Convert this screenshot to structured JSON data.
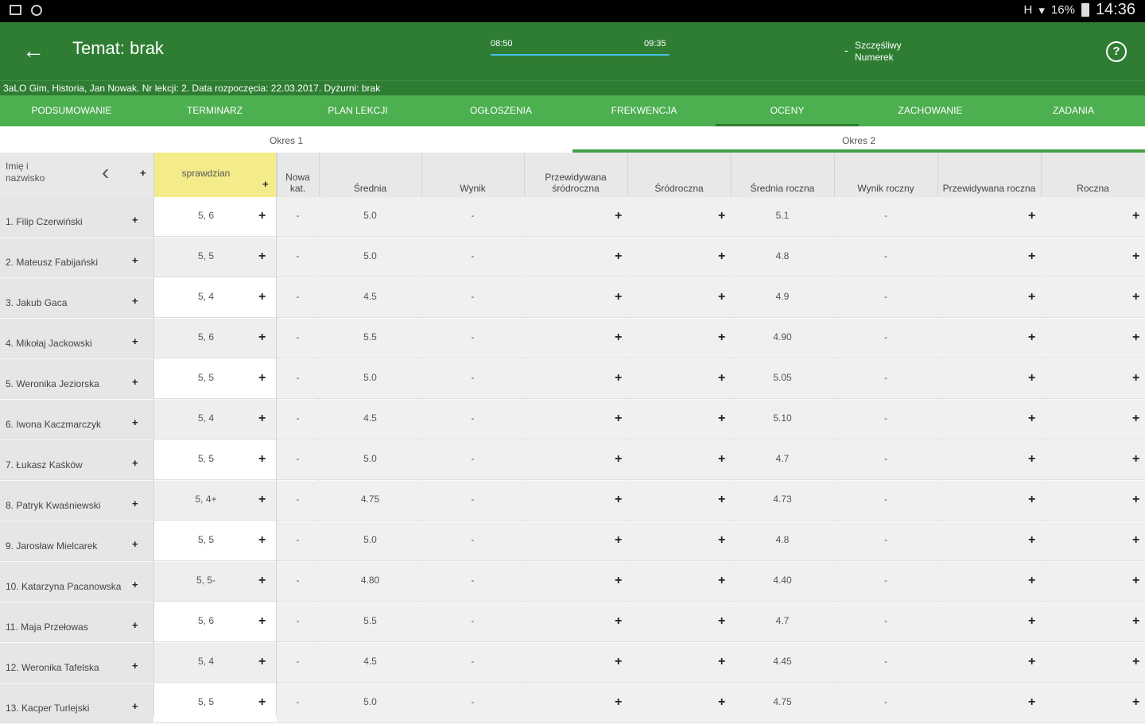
{
  "status_bar": {
    "signal_label": "H",
    "battery": "16%",
    "time": "14:36"
  },
  "app_bar": {
    "back_icon": "arrow-left-icon",
    "title": "Temat: brak",
    "time_start": "08:50",
    "time_end": "09:35",
    "lesson_progress": 1.0,
    "lucky_dash": "-",
    "lucky_label": "Szczęśliwy Numerek",
    "help_icon": "help-circle-icon",
    "help_glyph": "?"
  },
  "info_line": "3aLO Gim, Historia, Jan Nowak. Nr lekcji: 2. Data rozpoczęcia: 22.03.2017. Dyżurni: brak",
  "tabs": [
    {
      "label": "PODSUMOWANIE"
    },
    {
      "label": "TERMINARZ"
    },
    {
      "label": "PLAN LEKCJI"
    },
    {
      "label": "OGŁOSZENIA"
    },
    {
      "label": "FREKWENCJA"
    },
    {
      "label": "OCENY",
      "active": true
    },
    {
      "label": "ZACHOWANIE"
    },
    {
      "label": "ZADANIA"
    }
  ],
  "periods": [
    {
      "label": "Okres 1"
    },
    {
      "label": "Okres 2",
      "active": true
    }
  ],
  "table": {
    "name_header": "Imię i nazwisko",
    "collapse_glyph": "‹",
    "plus_glyph": "+",
    "grade_header": "sprawdzian",
    "columns": [
      "Nowa kat.",
      "Średnia",
      "Wynik",
      "Przewidywana śródroczna",
      "Śródroczna",
      "Średnia roczna",
      "Wynik roczny",
      "Przewidywana roczna",
      "Roczna"
    ],
    "accent_color": "#f4ec8b",
    "rows": [
      {
        "name": "1. Filip Czerwiński",
        "grades": "5, 6",
        "nowa": "-",
        "srednia": "5.0",
        "wynik": "-",
        "srednia_roczna": "5.1",
        "wynik_roczny": "-"
      },
      {
        "name": "2. Mateusz Fabijański",
        "grades": "5, 5",
        "nowa": "-",
        "srednia": "5.0",
        "wynik": "-",
        "srednia_roczna": "4.8",
        "wynik_roczny": "-"
      },
      {
        "name": "3. Jakub Gaca",
        "grades": "5, 4",
        "nowa": "-",
        "srednia": "4.5",
        "wynik": "-",
        "srednia_roczna": "4.9",
        "wynik_roczny": "-"
      },
      {
        "name": "4. Mikołaj Jackowski",
        "grades": "5, 6",
        "nowa": "-",
        "srednia": "5.5",
        "wynik": "-",
        "srednia_roczna": "4.90",
        "wynik_roczny": "-"
      },
      {
        "name": "5. Weronika Jeziorska",
        "grades": "5, 5",
        "nowa": "-",
        "srednia": "5.0",
        "wynik": "-",
        "srednia_roczna": "5.05",
        "wynik_roczny": "-"
      },
      {
        "name": "6. Iwona Kaczmarczyk",
        "grades": "5, 4",
        "nowa": "-",
        "srednia": "4.5",
        "wynik": "-",
        "srednia_roczna": "5.10",
        "wynik_roczny": "-"
      },
      {
        "name": "7. Łukasz Kaśków",
        "grades": "5, 5",
        "nowa": "-",
        "srednia": "5.0",
        "wynik": "-",
        "srednia_roczna": "4.7",
        "wynik_roczny": "-"
      },
      {
        "name": "8. Patryk Kwaśniewski",
        "grades": "5, 4+",
        "nowa": "-",
        "srednia": "4.75",
        "wynik": "-",
        "srednia_roczna": "4.73",
        "wynik_roczny": "-"
      },
      {
        "name": "9. Jarosław Mielcarek",
        "grades": "5, 5",
        "nowa": "-",
        "srednia": "5.0",
        "wynik": "-",
        "srednia_roczna": "4.8",
        "wynik_roczny": "-"
      },
      {
        "name": "10. Katarzyna Pacanowska",
        "grades": "5, 5-",
        "nowa": "-",
        "srednia": "4.80",
        "wynik": "-",
        "srednia_roczna": "4.40",
        "wynik_roczny": "-"
      },
      {
        "name": "11. Maja Przełowas",
        "grades": "5, 6",
        "nowa": "-",
        "srednia": "5.5",
        "wynik": "-",
        "srednia_roczna": "4.7",
        "wynik_roczny": "-"
      },
      {
        "name": "12. Weronika Tafelska",
        "grades": "5, 4",
        "nowa": "-",
        "srednia": "4.5",
        "wynik": "-",
        "srednia_roczna": "4.45",
        "wynik_roczny": "-"
      },
      {
        "name": "13. Kacper Turlejski",
        "grades": "5, 5",
        "nowa": "-",
        "srednia": "5.0",
        "wynik": "-",
        "srednia_roczna": "4.75",
        "wynik_roczny": "-"
      }
    ]
  }
}
